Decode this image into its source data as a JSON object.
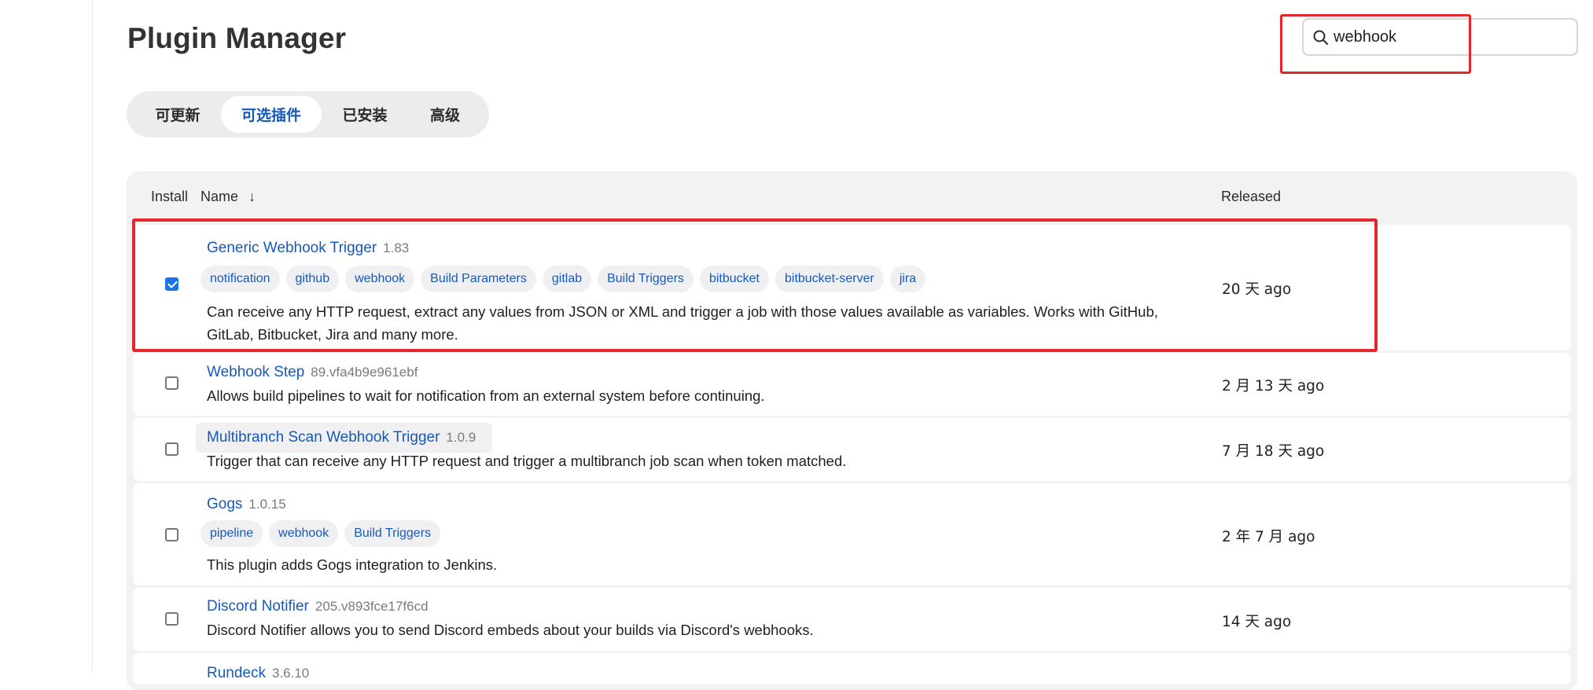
{
  "page": {
    "title": "Plugin Manager"
  },
  "search": {
    "value": "webhook",
    "placeholder": ""
  },
  "tabs": [
    {
      "label": "可更新",
      "active": false
    },
    {
      "label": "可选插件",
      "active": true
    },
    {
      "label": "已安装",
      "active": false
    },
    {
      "label": "高级",
      "active": false
    }
  ],
  "table": {
    "headers": {
      "install": "Install",
      "name": "Name",
      "sort": "↓",
      "released": "Released"
    },
    "rows": [
      {
        "name": "Generic Webhook Trigger",
        "version": "1.83",
        "checked": true,
        "tags": [
          "notification",
          "github",
          "webhook",
          "Build Parameters",
          "gitlab",
          "Build Triggers",
          "bitbucket",
          "bitbucket-server",
          "jira"
        ],
        "description_line1": "Can receive any HTTP request, extract any values from JSON or XML and trigger a job with those values available as variables. Works with GitHub,",
        "description_line2": "GitLab, Bitbucket, Jira and many more.",
        "released": "20 天 ago"
      },
      {
        "name": "Webhook Step",
        "version": "89.vfa4b9e961ebf",
        "checked": false,
        "tags": [],
        "description_line1": "Allows build pipelines to wait for notification from an external system before continuing.",
        "released": "2 月 13 天 ago"
      },
      {
        "name": "Multibranch Scan Webhook Trigger",
        "version": "1.0.9",
        "checked": false,
        "tags": [],
        "description_line1": "Trigger that can receive any HTTP request and trigger a multibranch job scan when token matched.",
        "released": "7 月 18 天 ago"
      },
      {
        "name": "Gogs",
        "version": "1.0.15",
        "checked": false,
        "tags": [
          "pipeline",
          "webhook",
          "Build Triggers"
        ],
        "description_line1": "This plugin adds Gogs integration to Jenkins.",
        "released": "2 年 7 月 ago"
      },
      {
        "name": "Discord Notifier",
        "version": "205.v893fce17f6cd",
        "checked": false,
        "tags": [],
        "description_line1": "Discord Notifier allows you to send Discord embeds about your builds via Discord's webhooks.",
        "released": "14 天 ago"
      },
      {
        "name": "Rundeck",
        "version": "3.6.10",
        "checked": false,
        "tags": [],
        "description_line1": "",
        "released": ""
      }
    ]
  },
  "colors": {
    "accent": "#1659b8",
    "highlight": "#e5272b",
    "table_bg": "#f2f2f3"
  }
}
